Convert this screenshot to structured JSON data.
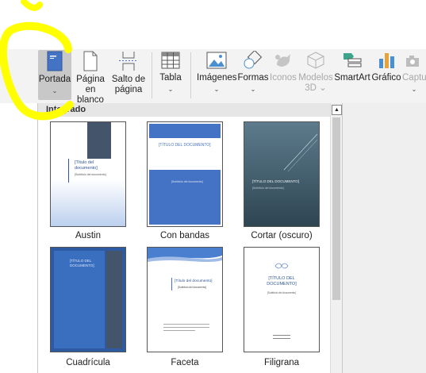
{
  "ribbon": {
    "buttons": [
      {
        "key": "portada",
        "label": "Portada",
        "caret": "⌄"
      },
      {
        "key": "pagina",
        "label_line1": "Página",
        "label_line2": "en blanco"
      },
      {
        "key": "salto",
        "label_line1": "Salto de",
        "label_line2": "página"
      },
      {
        "key": "tabla",
        "label": "Tabla",
        "caret": "⌄"
      },
      {
        "key": "imagenes",
        "label": "Imágenes",
        "caret": "⌄"
      },
      {
        "key": "formas",
        "label": "Formas",
        "caret": "⌄"
      },
      {
        "key": "iconos",
        "label": "Iconos"
      },
      {
        "key": "modelos",
        "label_line1": "Modelos",
        "label_line2": "3D ⌄"
      },
      {
        "key": "smartart",
        "label": "SmartArt"
      },
      {
        "key": "grafico",
        "label": "Gráfico"
      },
      {
        "key": "captura",
        "label": "Captu",
        "caret": "⌄"
      }
    ]
  },
  "panel": {
    "header": "Integrado",
    "scroll_up": "▲",
    "templates": [
      {
        "name": "Austin",
        "text_line1": "[Título del",
        "text_line2": "documento]",
        "text_line3": "[Subtítulo del documento]"
      },
      {
        "name": "Con bandas",
        "text_line1": "[TÍTULO DEL DOCUMENTO]",
        "text_line2": "[Subtítulo del documento]"
      },
      {
        "name": "Cortar (oscuro)",
        "text_line1": "[TÍTULO DEL DOCUMENTO]",
        "text_line2": "[Subtítulo del documento]"
      },
      {
        "name": "Cuadrícula",
        "text_line1": "[TÍTULO DEL",
        "text_line2": "DOCUMENTO]"
      },
      {
        "name": "Faceta",
        "text_line1": "[Título del documento]",
        "text_line2": "[Subtítulo del documento]"
      },
      {
        "name": "Filigrana",
        "text_line1": "[TÍTULO DEL",
        "text_line2": "DOCUMENTO]",
        "text_line3": "[Subtítulo del documento]"
      }
    ]
  },
  "colors": {
    "accent_blue": "#4472c4",
    "annotation": "#ffff00",
    "ribbon_bg": "#f3f3f3"
  }
}
